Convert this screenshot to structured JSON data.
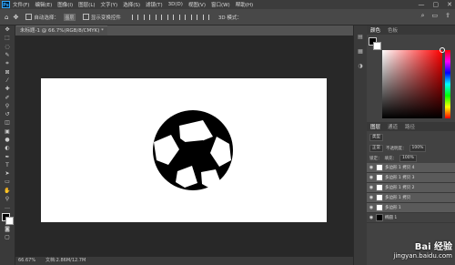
{
  "menubar": {
    "logo": "Ps",
    "items": [
      "文件(F)",
      "编辑(E)",
      "图像(I)",
      "图层(L)",
      "文字(Y)",
      "选择(S)",
      "滤镜(T)",
      "3D(D)",
      "视图(V)",
      "窗口(W)",
      "帮助(H)"
    ],
    "window_controls": [
      "—",
      "▢",
      "✕"
    ]
  },
  "options": {
    "auto_select": "自动选择：",
    "layer_select": "图层",
    "show_transform": "显示变换控件",
    "mode_3d": "3D 模式："
  },
  "document": {
    "tab_title": "未标题-1 @ 66.7%(RGB/8/CMYK) *",
    "zoom": "66.67%",
    "doc_info": "文档:2.86M/12.7M"
  },
  "panels": {
    "tab_swatches": "颜色",
    "tab_color": "色板",
    "tab_layers": "图层",
    "tab_channels": "通道",
    "tab_paths": "路径",
    "blend_mode": "正常",
    "opacity_label": "不透明度：",
    "opacity": "100%",
    "fill_label": "填充：",
    "fill": "100%",
    "lock_label": "锁定：",
    "filter_label": "类型"
  },
  "layers": [
    {
      "name": "多边形 1 拷贝 4"
    },
    {
      "name": "多边形 1 拷贝 3"
    },
    {
      "name": "多边形 1 拷贝 2"
    },
    {
      "name": "多边形 1 拷贝"
    },
    {
      "name": "多边形 1"
    },
    {
      "name": "椭圆 1"
    }
  ],
  "colors": {
    "accent": "#31a8ff",
    "canvas": "#ffffff",
    "workspace": "#282828"
  },
  "watermark": {
    "top": "Bai 经验",
    "bottom": "jingyan.baidu.com"
  }
}
